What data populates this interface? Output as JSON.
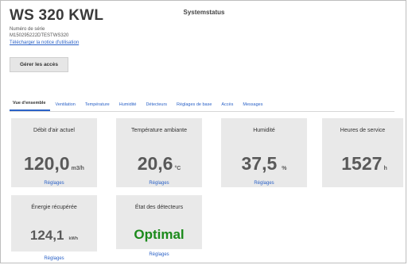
{
  "header": {
    "model": "WS 320 KWL",
    "title": "Systemstatus",
    "serial_label": "Numéro de série",
    "serial_value": "M150295222DTESTWS320",
    "manual_link": "Télécharger la notice d'utilisation",
    "access_button": "Gérer les accès"
  },
  "tabs": [
    {
      "label": "Vue d'ensemble",
      "active": true
    },
    {
      "label": "Ventilation"
    },
    {
      "label": "Température"
    },
    {
      "label": "Humidité"
    },
    {
      "label": "Détecteurs"
    },
    {
      "label": "Réglages de base"
    },
    {
      "label": "Accès"
    },
    {
      "label": "Messages"
    }
  ],
  "cards": [
    {
      "title": "Débit d'air actuel",
      "value": "120,0",
      "unit": "m3/h",
      "link": "Réglages"
    },
    {
      "title": "Température ambiante",
      "value": "20,6",
      "unit": "°C",
      "link": "Réglages"
    },
    {
      "title": "Humidité",
      "value": "37,5",
      "unit": "%",
      "link": "Réglages"
    },
    {
      "title": "Heures de service",
      "value": "1527",
      "unit": "h",
      "link": ""
    },
    {
      "title": "Énergie récupérée",
      "value": "124,1",
      "unit": "kWh",
      "link": "Réglages"
    },
    {
      "title": "État des détecteurs",
      "value": "Optimal",
      "unit": "",
      "link": "Réglages"
    }
  ]
}
